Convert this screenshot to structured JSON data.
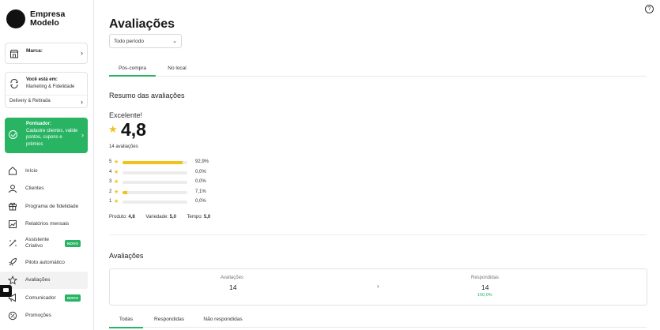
{
  "brand": {
    "name": "Empresa Modelo"
  },
  "sidebar": {
    "brand_card": {
      "label": "Marca:"
    },
    "location_card": {
      "title": "Você está em:",
      "module": "Marketing & Fidelidade",
      "channel": "Delivery & Retirada"
    },
    "promo": {
      "title": "Pontuador:",
      "description": "Cadastre clientes, valide pontos, cupons e prêmios"
    },
    "nav": [
      {
        "label": "Início",
        "icon": "home-icon"
      },
      {
        "label": "Clientes",
        "icon": "user-icon"
      },
      {
        "label": "Programa de fidelidade",
        "icon": "gift-icon"
      },
      {
        "label": "Relatórios mensais",
        "icon": "chart-icon"
      },
      {
        "label": "Assistente Criativo",
        "icon": "magic-icon",
        "badge": "NOVO"
      },
      {
        "label": "Piloto automático",
        "icon": "rocket-icon"
      },
      {
        "label": "Avaliações",
        "icon": "star-icon",
        "active": true
      },
      {
        "label": "Comunicador",
        "icon": "megaphone-icon",
        "badge": "NOVO"
      },
      {
        "label": "Promoções",
        "icon": "percent-icon"
      }
    ]
  },
  "header": {
    "title": "Avaliações",
    "period": "Todo período",
    "help": "?"
  },
  "tabs_top": [
    {
      "label": "Pós-compra",
      "active": true
    },
    {
      "label": "No local",
      "active": false
    }
  ],
  "summary": {
    "section_title": "Resumo das avaliações",
    "rating_word": "Excelente!",
    "score": "4,8",
    "count_text": "14 avaliações",
    "distribution": [
      {
        "stars": "5",
        "pct_text": "92,9%",
        "fraction": 0.929
      },
      {
        "stars": "4",
        "pct_text": "0,0%",
        "fraction": 0
      },
      {
        "stars": "3",
        "pct_text": "0,0%",
        "fraction": 0
      },
      {
        "stars": "2",
        "pct_text": "7,1%",
        "fraction": 0.071
      },
      {
        "stars": "1",
        "pct_text": "0,0%",
        "fraction": 0
      }
    ],
    "sub_scores": [
      {
        "label": "Produto:",
        "value": "4,8"
      },
      {
        "label": "Variedade:",
        "value": "5,0"
      },
      {
        "label": "Tempo:",
        "value": "5,0"
      }
    ]
  },
  "reviews": {
    "section_title": "Avaliações",
    "stats": {
      "total_label": "Avaliações",
      "total_value": "14",
      "answered_label": "Respondidas",
      "answered_value": "14",
      "answered_pct": "100,0%"
    },
    "tabs": [
      {
        "label": "Todas",
        "active": true
      },
      {
        "label": "Respondidas",
        "active": false
      },
      {
        "label": "Não respondidas",
        "active": false
      }
    ]
  },
  "colors": {
    "accent": "#28b463",
    "star": "#f2c11b"
  }
}
